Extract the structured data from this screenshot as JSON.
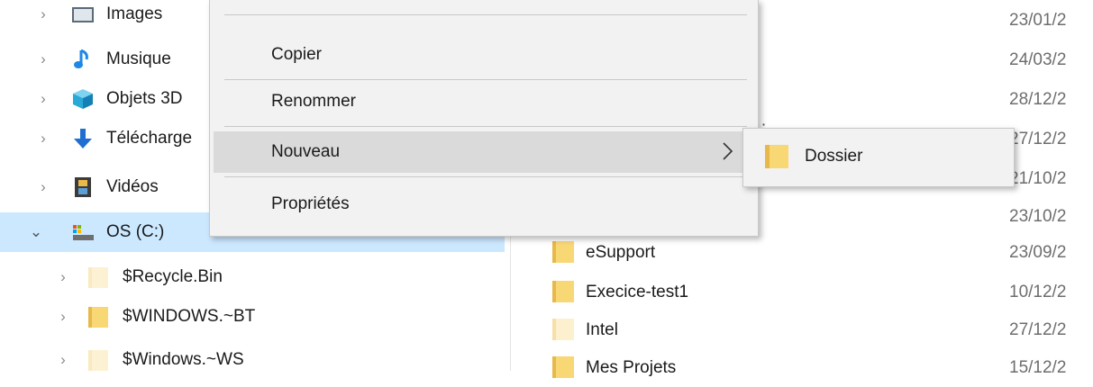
{
  "nav": {
    "items": [
      {
        "label": "Images",
        "icon": "images-folder-icon"
      },
      {
        "label": "Musique",
        "icon": "music-note-icon"
      },
      {
        "label": "Objets 3D",
        "icon": "3d-objects-icon"
      },
      {
        "label": "Télécharge",
        "icon": "download-arrow-icon"
      },
      {
        "label": "Vidéos",
        "icon": "film-icon"
      },
      {
        "label": "OS (C:)",
        "icon": "drive-icon",
        "selected": true,
        "expanded": true
      },
      {
        "label": "$Recycle.Bin",
        "icon": "folder-hidden-icon"
      },
      {
        "label": "$WINDOWS.~BT",
        "icon": "folder-icon"
      },
      {
        "label": "$Windows.~WS",
        "icon": "folder-hidden-icon"
      }
    ]
  },
  "files": {
    "dates_only": [
      "23/01/2",
      "24/03/2",
      "28/12/2",
      "27/12/2",
      "21/10/2",
      "23/10/2"
    ],
    "rows": [
      {
        "name": "eSupport",
        "date": "23/09/2"
      },
      {
        "name": "Execice-test1",
        "date": "10/12/2"
      },
      {
        "name": "Intel",
        "date": "27/12/2"
      },
      {
        "name": "Mes Projets",
        "date": "15/12/2"
      }
    ],
    "partial_text": "··"
  },
  "context_menu": {
    "items": [
      {
        "label": "Copier"
      },
      {
        "label": "Renommer"
      },
      {
        "label": "Nouveau",
        "has_submenu": true,
        "highlighted": true
      },
      {
        "label": "Propriétés"
      }
    ]
  },
  "submenu": {
    "items": [
      {
        "label": "Dossier",
        "icon": "folder-icon"
      }
    ]
  },
  "colors": {
    "selection": "#cce8ff",
    "menu_bg": "#f2f2f2",
    "menu_hover": "#dadada",
    "folder": "#f8d775",
    "folder_hidden": "#fbe9bf"
  }
}
